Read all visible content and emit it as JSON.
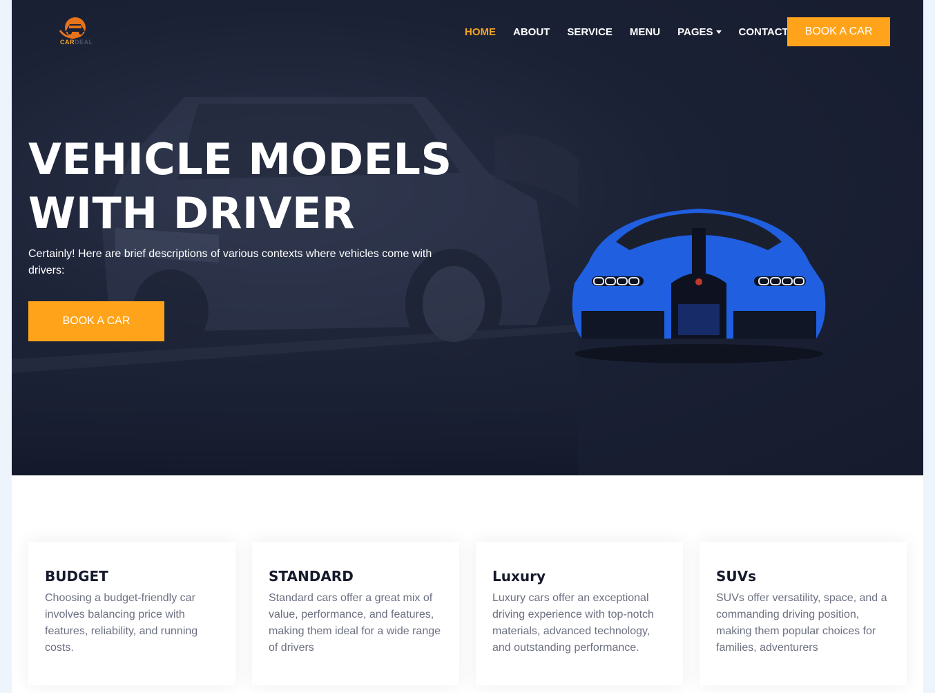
{
  "brand": {
    "logo_primary": "CAR",
    "logo_secondary": "DEAL",
    "accent_color": "#ffa31a"
  },
  "nav": {
    "items": [
      {
        "label": "HOME",
        "active": true
      },
      {
        "label": "ABOUT",
        "active": false
      },
      {
        "label": "SERVICE",
        "active": false
      },
      {
        "label": "MENU",
        "active": false
      },
      {
        "label": "PAGES",
        "active": false,
        "dropdown": true
      },
      {
        "label": "CONTACT",
        "active": false
      }
    ],
    "cta_label": "BOOK A CAR"
  },
  "hero": {
    "title_line1": "VEHICLE MODELS",
    "title_line2": "WITH DRIVER",
    "description": "Certainly! Here are brief descriptions of various contexts where vehicles come with drivers:",
    "cta_label": "BOOK A CAR"
  },
  "cards": [
    {
      "title": "BUDGET",
      "text": "Choosing a budget-friendly car involves balancing price with features, reliability, and running costs."
    },
    {
      "title": "STANDARD",
      "text": "Standard cars offer a great mix of value, performance, and features, making them ideal for a wide range of drivers"
    },
    {
      "title": "Luxury",
      "text": "Luxury cars offer an exceptional driving experience with top-notch materials, advanced technology, and outstanding performance."
    },
    {
      "title": "SUVs",
      "text": "SUVs offer versatility, space, and a commanding driving position, making them popular choices for families, adventurers"
    }
  ]
}
